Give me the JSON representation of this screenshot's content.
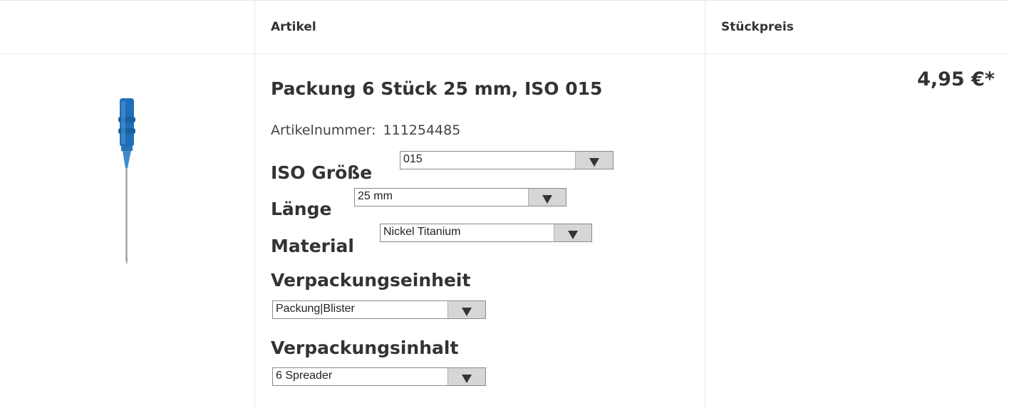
{
  "table": {
    "headers": {
      "image": "",
      "article": "Artikel",
      "price": "Stückpreis"
    }
  },
  "product": {
    "title": "Packung 6 Stück 25 mm, ISO 015",
    "article_number_label": "Artikelnummer:",
    "article_number": "111254485",
    "image_icon": "endodontic-file-spreader",
    "options": {
      "iso_size": {
        "label": "ISO Größe",
        "value": "015"
      },
      "length": {
        "label": "Länge",
        "value": "25 mm"
      },
      "material": {
        "label": "Material",
        "value": "Nickel Titanium"
      },
      "packaging_unit": {
        "label": "Verpackungseinheit",
        "value": "Packung|Blister"
      },
      "packaging_content": {
        "label": "Verpackungsinhalt",
        "value": "6 Spreader"
      }
    },
    "price": "4,95 €*"
  },
  "colors": {
    "handle": "#1e6fb5",
    "needle": "#b8b8b8",
    "arrow_bg": "#d6d6d6"
  }
}
